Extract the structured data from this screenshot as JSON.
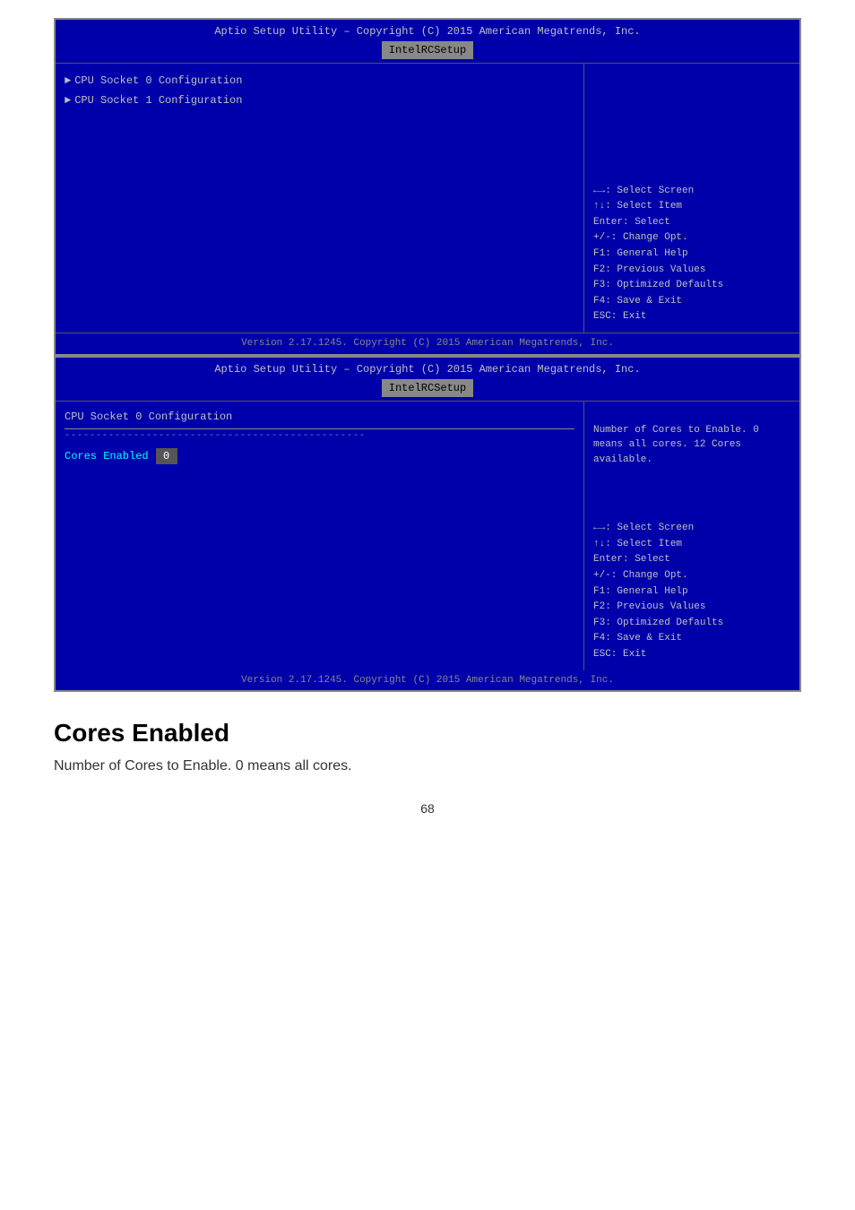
{
  "screen1": {
    "header_title": "Aptio Setup Utility – Copyright (C) 2015 American Megatrends, Inc.",
    "tab_label": "IntelRCSetup",
    "menu_items": [
      {
        "label": "CPU Socket 0 Configuration",
        "has_arrow": true
      },
      {
        "label": "CPU Socket 1 Configuration",
        "has_arrow": true
      }
    ],
    "help": {
      "select_screen": "←→: Select Screen",
      "select_item": "↑↓: Select Item",
      "enter": "Enter: Select",
      "change_opt": "+/-: Change Opt.",
      "general_help": "F1: General Help",
      "previous_values": "F2: Previous Values",
      "optimized_defaults": "F3: Optimized Defaults",
      "save_exit": "F4: Save & Exit",
      "esc_exit": "ESC: Exit"
    },
    "footer": "Version 2.17.1245. Copyright (C) 2015 American Megatrends, Inc."
  },
  "screen2": {
    "header_title": "Aptio Setup Utility – Copyright (C) 2015 American Megatrends, Inc.",
    "tab_label": "IntelRCSetup",
    "section_title": "CPU Socket 0 Configuration",
    "divider": "------------------------------------------------",
    "cores_label": "Cores Enabled",
    "cores_value": "0",
    "help_text": "Number of Cores to Enable. 0 means all cores. 12 Cores available.",
    "help": {
      "select_screen": "←→: Select Screen",
      "select_item": "↑↓: Select Item",
      "enter": "Enter: Select",
      "change_opt": "+/-: Change Opt.",
      "general_help": "F1: General Help",
      "previous_values": "F2: Previous Values",
      "optimized_defaults": "F3: Optimized Defaults",
      "save_exit": "F4: Save & Exit",
      "esc_exit": "ESC: Exit"
    },
    "footer": "Version 2.17.1245. Copyright (C) 2015 American Megatrends, Inc."
  },
  "bottom": {
    "title": "Cores Enabled",
    "description": "Number of Cores to Enable. 0 means all cores.",
    "page_number": "68"
  }
}
